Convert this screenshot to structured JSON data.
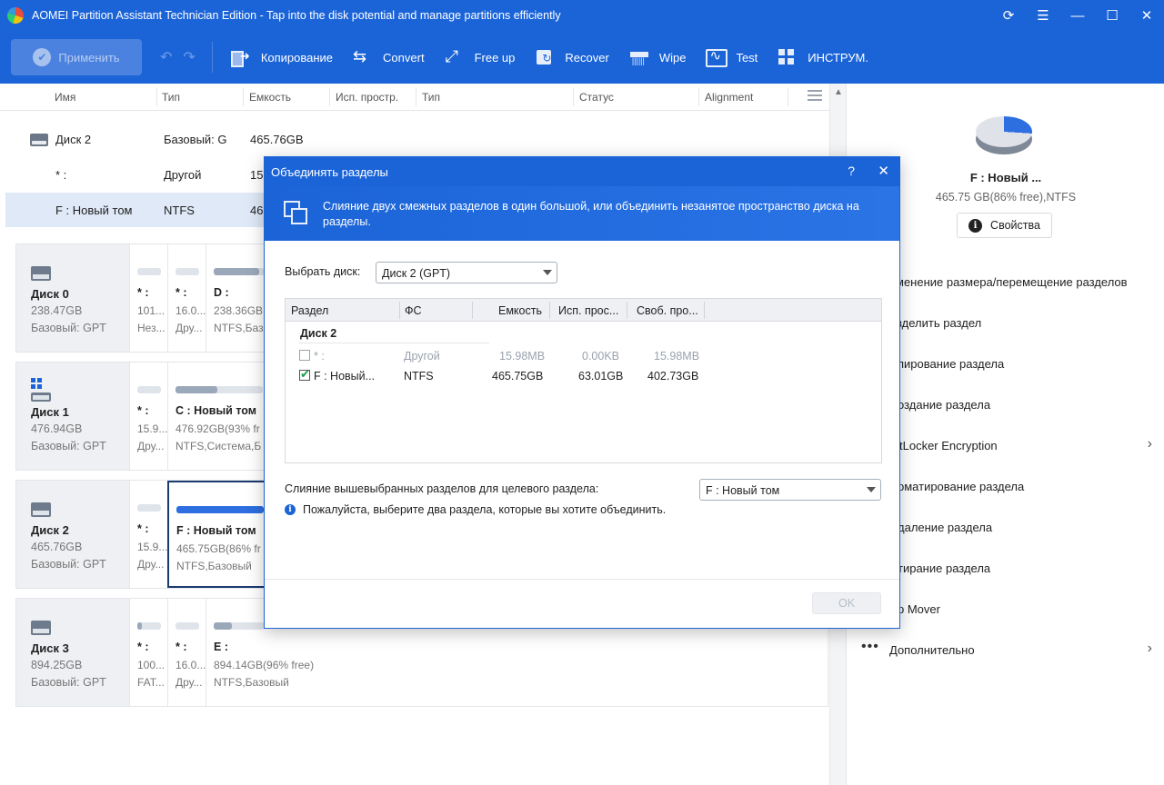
{
  "window": {
    "title": "AOMEI Partition Assistant Technician Edition - Tap into the disk potential and manage partitions efficiently",
    "controls": [
      "⟳",
      "☰",
      "—",
      "☐",
      "✕"
    ]
  },
  "toolbar": {
    "apply": "Применить",
    "undo": "↶",
    "redo": "↷",
    "tools": [
      {
        "label": "Копирование",
        "icon": "copy-icon"
      },
      {
        "label": "Convert",
        "icon": "convert-icon"
      },
      {
        "label": "Free up",
        "icon": "free-up-icon"
      },
      {
        "label": "Recover",
        "icon": "recover-icon"
      },
      {
        "label": "Wipe",
        "icon": "wipe-icon"
      },
      {
        "label": "Test",
        "icon": "test-icon"
      },
      {
        "label": "ИНСТРУМ.",
        "icon": "tools-icon"
      }
    ]
  },
  "table": {
    "columns": [
      "Имя",
      "Тип",
      "Емкость",
      "Исп. простр.",
      "Тип",
      "Статус",
      "Alignment"
    ],
    "rows": [
      {
        "name": "Диск 2",
        "type": "Базовый: G",
        "capacity": "465.76GB"
      },
      {
        "name": "* :",
        "type": "Другой",
        "capacity": "15."
      },
      {
        "name": "F : Новый том",
        "type": "NTFS",
        "capacity": "46"
      }
    ]
  },
  "disks": [
    {
      "name": "Диск 0",
      "size": "238.47GB",
      "type": "Базовый: GPT",
      "parts": [
        {
          "name": "* :",
          "size": "101...",
          "type": "Нез...",
          "fill": 0
        },
        {
          "name": "* :",
          "size": "16.0...",
          "type": "Дру...",
          "fill": 0
        },
        {
          "name": "D :",
          "size": "238.36GB",
          "type": "NTFS,Баз",
          "fill": 0.9
        }
      ]
    },
    {
      "name": "Диск 1",
      "size": "476.94GB",
      "type": "Базовый: GPT",
      "parts": [
        {
          "name": "* :",
          "size": "15.9...",
          "type": "Дру...",
          "fill": 0
        },
        {
          "name": "C : Новый том",
          "size": "476.92GB(93% fr",
          "type": "NTFS,Система,Б",
          "fill": 0.07
        }
      ]
    },
    {
      "name": "Диск 2",
      "size": "465.76GB",
      "type": "Базовый: GPT",
      "parts": [
        {
          "name": "* :",
          "size": "15.9...",
          "type": "Дру...",
          "fill": 0
        },
        {
          "name": "F : Новый том",
          "size": "465.75GB(86% fr",
          "type": "NTFS,Базовый",
          "fill": 0.14
        }
      ]
    },
    {
      "name": "Диск 3",
      "size": "894.25GB",
      "type": "Базовый: GPT",
      "parts": [
        {
          "name": "* :",
          "size": "100...",
          "type": "FAT...",
          "fill": 0.2
        },
        {
          "name": "* :",
          "size": "16.0...",
          "type": "Дру...",
          "fill": 0
        },
        {
          "name": "E :",
          "size": "894.14GB(96% free)",
          "type": "NTFS,Базовый",
          "fill": 0.04
        }
      ]
    }
  ],
  "right_panel": {
    "name": "F : Новый ...",
    "free": "465.75 GB(86% free),NTFS",
    "props": "Свойства",
    "operations": [
      "менение размера/перемещение разделов",
      "зделить раздел",
      "пирование раздела",
      "оздание раздела",
      "tLocker Encryption",
      "рматирование раздела",
      "даление раздела",
      "тирание раздела",
      "p Mover",
      "Дополнительно"
    ]
  },
  "dialog": {
    "title": "Объединять разделы",
    "help": "?",
    "close": "✕",
    "banner": "Слияние двух смежных разделов в один большой, или объединить незанятое пространство диска на разделы.",
    "select_disk_label": "Выбрать диск:",
    "select_disk_value": "Диск 2 (GPT)",
    "columns": [
      "Раздел",
      "ФС",
      "Емкость",
      "Исп. прос...",
      "Своб. про..."
    ],
    "group": "Диск 2",
    "rows": [
      {
        "name": "* :",
        "fs": "Другой",
        "cap": "15.98MB",
        "used": "0.00KB",
        "free": "15.98MB",
        "checked": false
      },
      {
        "name": "F :  Новый...",
        "fs": "NTFS",
        "cap": "465.75GB",
        "used": "63.01GB",
        "free": "402.73GB",
        "checked": true
      }
    ],
    "target_label": "Слияние вышевыбранных разделов для целевого раздела:",
    "target_value": "F :  Новый том",
    "note": "Пожалуйста, выберите два раздела, которые вы хотите объединить.",
    "ok": "OK"
  }
}
